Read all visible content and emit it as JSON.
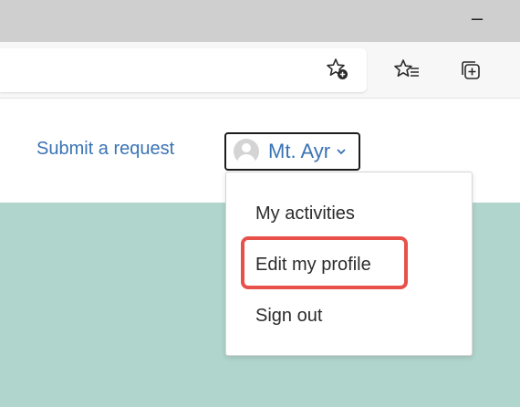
{
  "browser": {
    "minimize_glyph": "–",
    "toolbar_icons": [
      "favorite-add-icon",
      "favorites-icon",
      "collections-icon"
    ]
  },
  "header": {
    "submit_request": "Submit a request",
    "user_name": "Mt. Ayr"
  },
  "dropdown": {
    "items": [
      "My activities",
      "Edit my profile",
      "Sign out"
    ],
    "highlighted_item": "Edit my profile"
  },
  "colors": {
    "link": "#3a73b4",
    "hero": "#b0d5cc",
    "highlight": "#e8514a"
  }
}
